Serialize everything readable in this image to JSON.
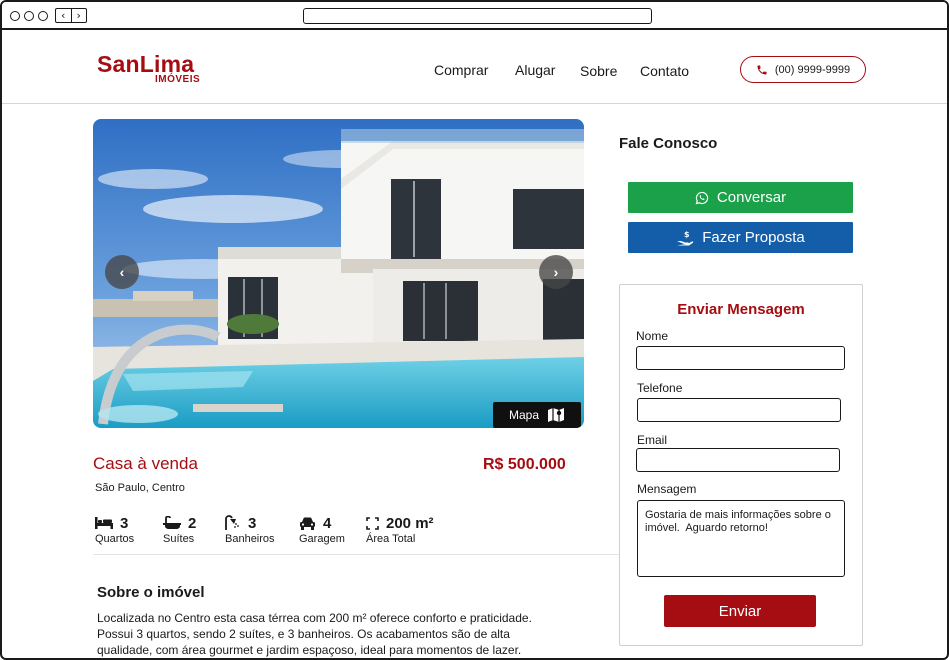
{
  "brand": {
    "name": "SanLima",
    "subtitle": "IMÓVEIS",
    "accent": "#a50d12"
  },
  "nav": {
    "items": [
      "Comprar",
      "Alugar",
      "Sobre",
      "Contato"
    ],
    "phone": "(00) 9999-9999"
  },
  "gallery": {
    "map_label": "Mapa",
    "prev_icon": "chevron-left-icon",
    "next_icon": "chevron-right-icon"
  },
  "property": {
    "title": "Casa à venda",
    "price": "R$ 500.000",
    "location": "São Paulo, Centro",
    "features": [
      {
        "icon": "bed-icon",
        "value": "3",
        "label": "Quartos"
      },
      {
        "icon": "bathtub-icon",
        "value": "2",
        "label": "Suítes"
      },
      {
        "icon": "shower-icon",
        "value": "3",
        "label": "Banheiros"
      },
      {
        "icon": "car-icon",
        "value": "4",
        "label": "Garagem"
      },
      {
        "icon": "area-icon",
        "value": "200 m²",
        "label": "Área Total"
      }
    ],
    "about_title": "Sobre o imóvel",
    "about_text": "Localizada no Centro esta casa térrea com 200 m² oferece conforto e praticidade. Possui 3 quartos, sendo 2 suítes, e 3 banheiros. Os acabamentos são de alta qualidade, com área gourmet e jardim espaçoso, ideal para momentos de lazer."
  },
  "contact": {
    "title": "Fale Conosco",
    "whatsapp_label": "Conversar",
    "whatsapp_color": "#1aa14a",
    "proposal_label": "Fazer Proposta",
    "proposal_color": "#145ea9"
  },
  "form": {
    "title": "Enviar Mensagem",
    "name_label": "Nome",
    "name_value": "",
    "phone_label": "Telefone",
    "phone_value": "",
    "email_label": "Email",
    "email_value": "",
    "message_label": "Mensagem",
    "message_value": "Gostaria de mais informações sobre o imóvel.  Aguardo retorno!",
    "submit_label": "Enviar"
  }
}
